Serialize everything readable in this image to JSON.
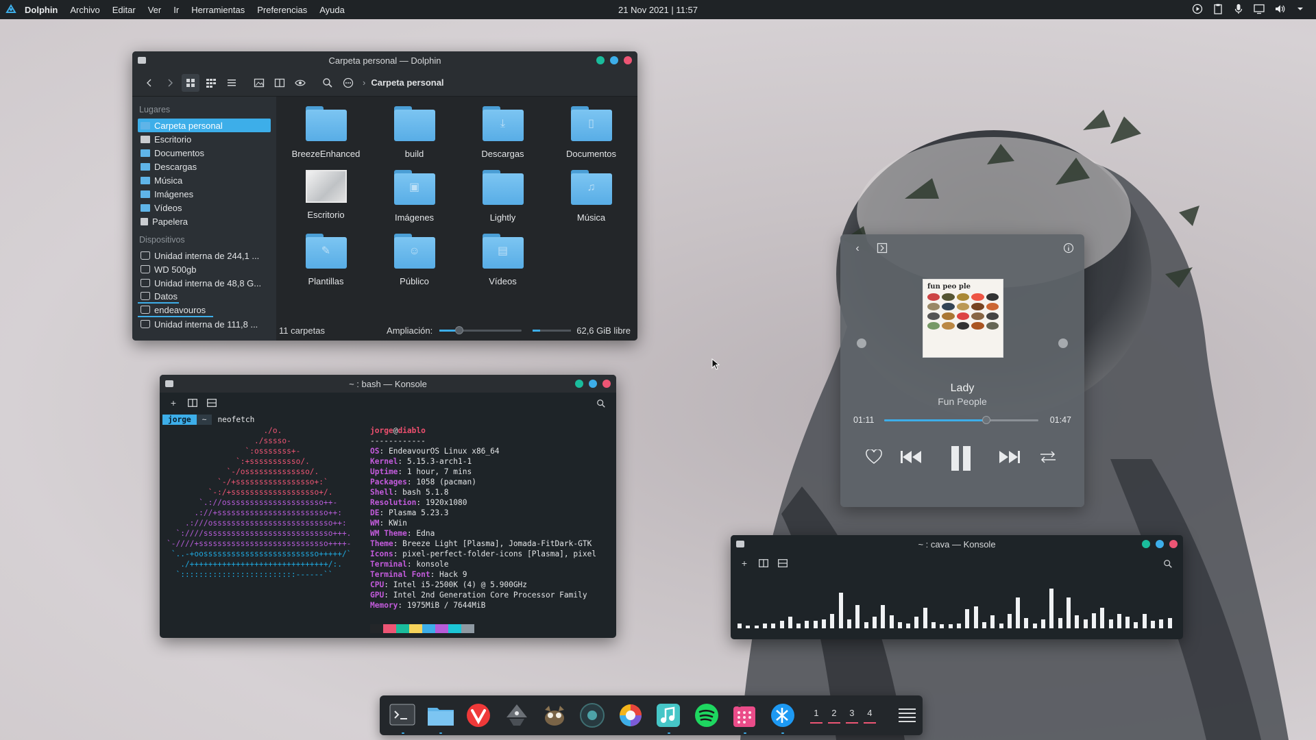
{
  "top_panel": {
    "app_name": "Dolphin",
    "menu": [
      "Archivo",
      "Editar",
      "Ver",
      "Ir",
      "Herramientas",
      "Preferencias",
      "Ayuda"
    ],
    "clock": "21 Nov 2021 | 11:57",
    "tray_icons": [
      "media-play-icon",
      "clipboard-icon",
      "microphone-icon",
      "display-icon",
      "volume-icon",
      "chevron-down-icon"
    ]
  },
  "dolphin": {
    "title": "Carpeta personal — Dolphin",
    "breadcrumb": "Carpeta personal",
    "places_header": "Lugares",
    "places": [
      {
        "label": "Carpeta personal",
        "selected": true
      },
      {
        "label": "Escritorio"
      },
      {
        "label": "Documentos"
      },
      {
        "label": "Descargas"
      },
      {
        "label": "Música"
      },
      {
        "label": "Imágenes"
      },
      {
        "label": "Vídeos"
      },
      {
        "label": "Papelera"
      }
    ],
    "devices_header": "Dispositivos",
    "devices": [
      "Unidad interna de 244,1 ...",
      "WD 500gb",
      "Unidad interna de 48,8 G...",
      "Datos",
      "endeavouros",
      "Unidad interna de 111,8 ..."
    ],
    "files": [
      {
        "name": "BreezeEnhanced",
        "glyph": ""
      },
      {
        "name": "build",
        "glyph": ""
      },
      {
        "name": "Descargas",
        "glyph": "⤓"
      },
      {
        "name": "Documentos",
        "glyph": "▯"
      },
      {
        "name": "Escritorio",
        "glyph": "thumb"
      },
      {
        "name": "Imágenes",
        "glyph": "▣"
      },
      {
        "name": "Lightly",
        "glyph": ""
      },
      {
        "name": "Música",
        "glyph": "♫"
      },
      {
        "name": "Plantillas",
        "glyph": "✎"
      },
      {
        "name": "Público",
        "glyph": "☺"
      },
      {
        "name": "Vídeos",
        "glyph": "▤"
      }
    ],
    "status_count": "11 carpetas",
    "zoom_label": "Ampliación:",
    "zoom_level": 0.24,
    "free_space": "62,6 GiB libre",
    "used_fraction": 0.2
  },
  "konsole": {
    "title": "~ : bash — Konsole",
    "prompt_user": "jorge",
    "prompt_dir": "~",
    "command": "neofetch",
    "ascii_art": [
      "                     ./o.",
      "                   ./sssso-",
      "                 `:osssssss+-",
      "               `:+sssssssssso/.",
      "             `-/ossssssssssssso/.",
      "           `-/+sssssssssssssssso+:`",
      "         `-:/+sssssssssssssssssso+/.",
      "       `.://osssssssssssssssssssso++-",
      "      .://+ssssssssssssssssssssssso++:",
      "    .:///ossssssssssssssssssssssssso++:",
      "  `:////ssssssssssssssssssssssssssso+++.",
      "`-////+ssssssssssssssssssssssssssso++++-",
      " `..-+oosssssssssssssssssssssssso+++++/`",
      "   ./++++++++++++++++++++++++++++++/:.",
      "  `:::::::::::::::::::::::::------``"
    ],
    "host_user": "jorge",
    "host_at": "@",
    "host_name": "diablo",
    "separator": "------------",
    "info": [
      {
        "k": "OS",
        "v": "EndeavourOS Linux x86_64"
      },
      {
        "k": "Kernel",
        "v": "5.15.3-arch1-1"
      },
      {
        "k": "Uptime",
        "v": "1 hour, 7 mins"
      },
      {
        "k": "Packages",
        "v": "1058 (pacman)"
      },
      {
        "k": "Shell",
        "v": "bash 5.1.8"
      },
      {
        "k": "Resolution",
        "v": "1920x1080"
      },
      {
        "k": "DE",
        "v": "Plasma 5.23.3"
      },
      {
        "k": "WM",
        "v": "KWin"
      },
      {
        "k": "WM Theme",
        "v": "Edna"
      },
      {
        "k": "Theme",
        "v": "Breeze Light [Plasma], Jomada-FitDark-GTK"
      },
      {
        "k": "Icons",
        "v": "pixel-perfect-folder-icons [Plasma], pixel"
      },
      {
        "k": "Terminal",
        "v": "konsole"
      },
      {
        "k": "Terminal Font",
        "v": "Hack 9"
      },
      {
        "k": "CPU",
        "v": "Intel i5-2500K (4) @ 5.900GHz"
      },
      {
        "k": "GPU",
        "v": "Intel 2nd Generation Core Processor Family"
      },
      {
        "k": "Memory",
        "v": "1975MiB / 7644MiB"
      }
    ],
    "palette": [
      "#232629",
      "#ed5574",
      "#1abc9c",
      "#f6d35b",
      "#3daee9",
      "#b65cd8",
      "#1cc6d6",
      "#8f9aa3"
    ]
  },
  "player": {
    "album_text": "fun peo ple",
    "title": "Lady",
    "artist": "Fun People",
    "elapsed": "01:11",
    "total": "01:47",
    "progress": 0.66,
    "colors": {
      "accent": "#3daee9"
    }
  },
  "cava": {
    "title": "~ : cava — Konsole",
    "levels": [
      4,
      2,
      2,
      4,
      4,
      6,
      9,
      4,
      6,
      6,
      7,
      11,
      28,
      7,
      18,
      5,
      9,
      18,
      10,
      5,
      4,
      9,
      16,
      5,
      3,
      3,
      4,
      15,
      17,
      5,
      10,
      4,
      11,
      24,
      8,
      4,
      7,
      31,
      8,
      24,
      10,
      7,
      12,
      16,
      7,
      11,
      9,
      5,
      11,
      6,
      7,
      8
    ]
  },
  "dock": {
    "apps": [
      "konsole-icon",
      "dolphin-icon",
      "vivaldi-icon",
      "inkscape-icon",
      "gimp-icon",
      "obs-icon",
      "color-picker-icon",
      "music-app-icon",
      "spotify-icon",
      "pomodoro-icon",
      "kde-connect-icon"
    ],
    "desktops": [
      "1",
      "2",
      "3",
      "4"
    ]
  }
}
